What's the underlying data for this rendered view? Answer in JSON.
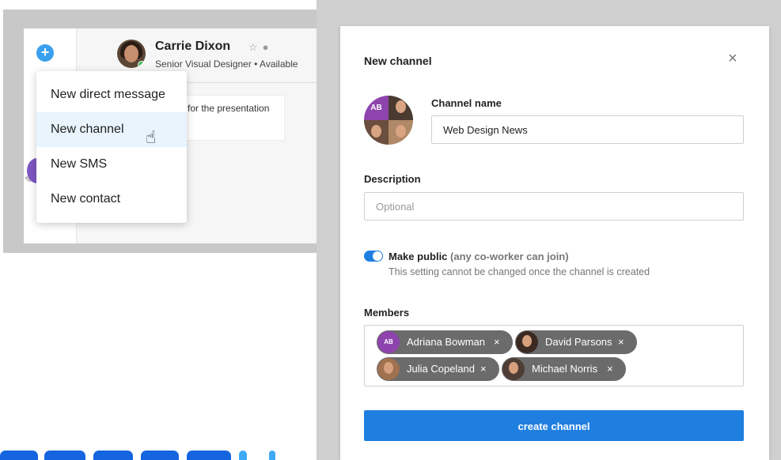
{
  "app": {
    "contact": {
      "name": "Carrie Dixon",
      "subtitle": "Senior Visual Designer • Available"
    },
    "message_preview": "for the presentation",
    "header_icons": [
      "star-icon",
      "chat-bubble-icon"
    ]
  },
  "dropdown": {
    "items": [
      {
        "label": "New direct message"
      },
      {
        "label": "New channel"
      },
      {
        "label": "New SMS"
      },
      {
        "label": "New contact"
      }
    ],
    "hovered_index": 1
  },
  "modal": {
    "title": "New channel",
    "close_glyph": "×",
    "group_avatar_initials": "AB",
    "channel_name": {
      "label": "Channel name",
      "value": "Web Design News"
    },
    "description": {
      "label": "Description",
      "placeholder": "Optional"
    },
    "make_public": {
      "enabled": true,
      "label": "Make public",
      "qualifier": "(any co-worker can join)",
      "help": "This setting cannot be changed once the channel is created"
    },
    "members": {
      "label": "Members",
      "chips": [
        {
          "name": "Adriana Bowman",
          "initials": "AB"
        },
        {
          "name": "David Parsons"
        },
        {
          "name": "Julia Copeland"
        },
        {
          "name": "Michael Norris"
        }
      ],
      "remove_glyph": "×"
    },
    "submit_label": "create channel"
  },
  "colors": {
    "accent": "#1f7fe0",
    "chip": "#6b6b6b",
    "avatar_purple": "#8e44ad",
    "hover": "#e9f4fd"
  }
}
